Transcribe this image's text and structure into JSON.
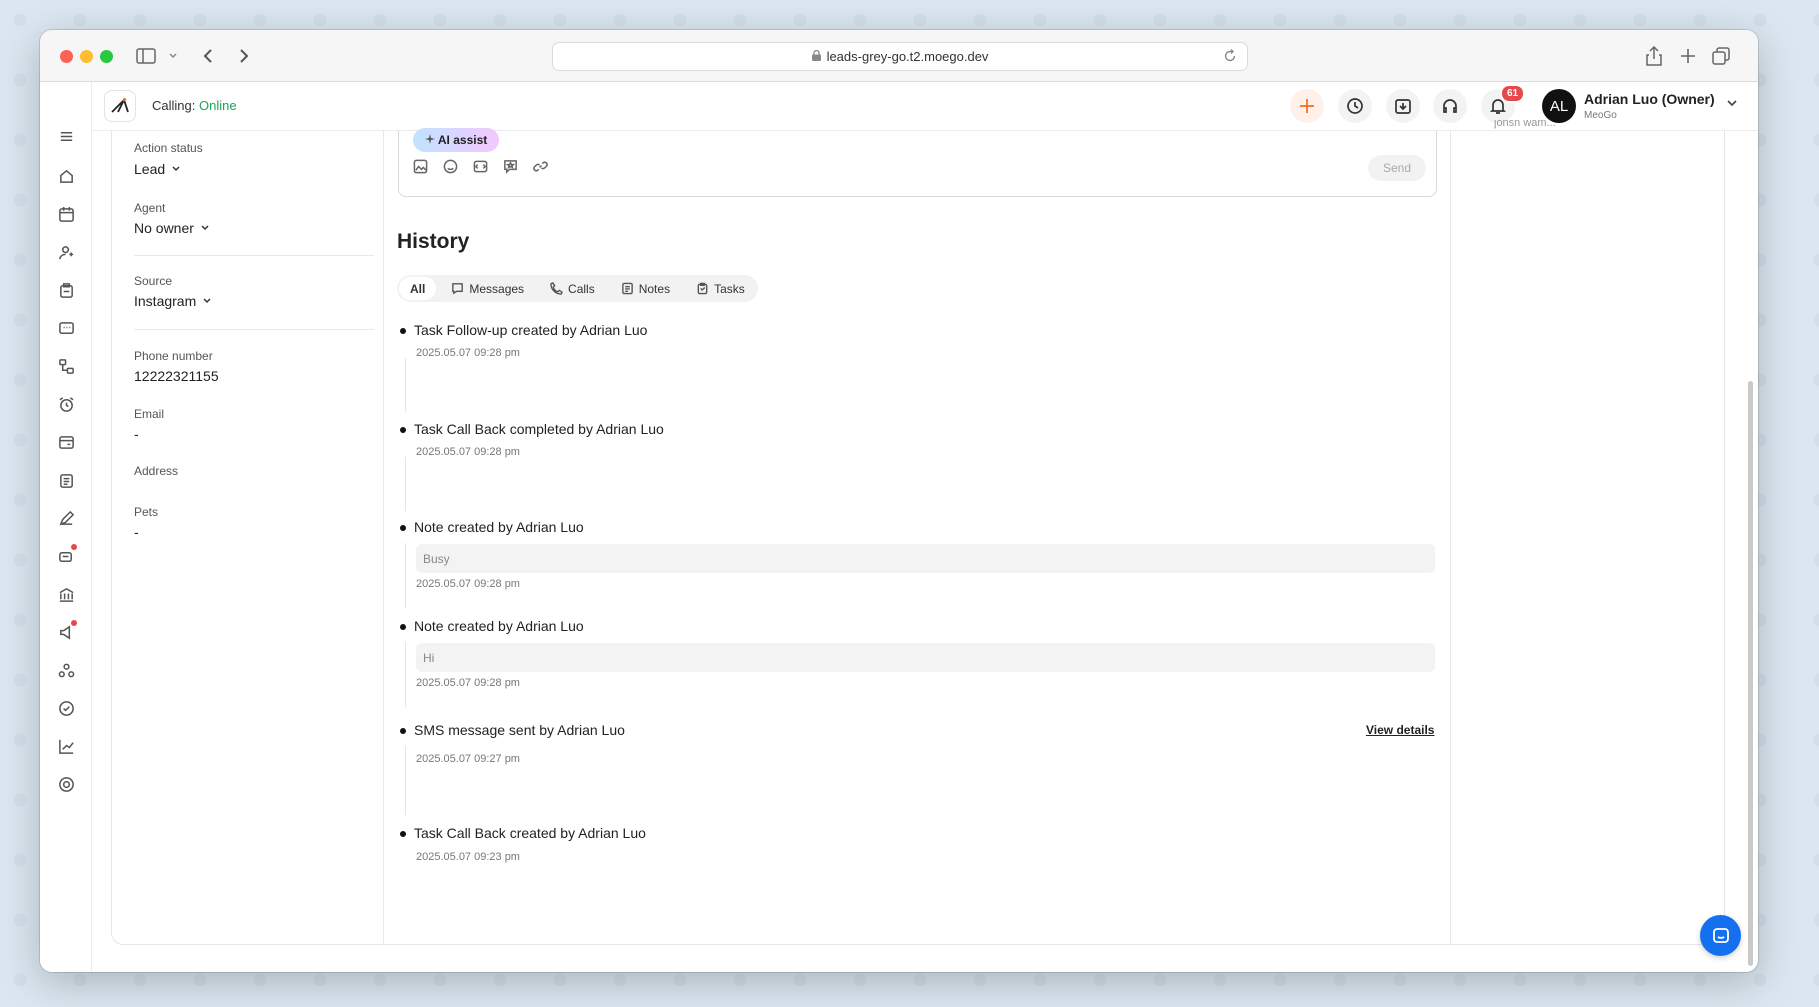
{
  "browser": {
    "url": "leads-grey-go.t2.moego.dev"
  },
  "header": {
    "calling_label": "Calling:",
    "calling_status": "Online",
    "notification_count": "61",
    "user_initials": "AL",
    "user_name": "Adrian Luo (Owner)",
    "business_name": "MeoGo"
  },
  "details": {
    "action_status": {
      "label": "Action status",
      "value": "Lead"
    },
    "agent": {
      "label": "Agent",
      "value": "No owner"
    },
    "source": {
      "label": "Source",
      "value": "Instagram"
    },
    "phone": {
      "label": "Phone number",
      "value": "12222321155"
    },
    "email": {
      "label": "Email",
      "value": "-"
    },
    "address": {
      "label": "Address"
    },
    "pets": {
      "label": "Pets",
      "value": "-"
    }
  },
  "composer": {
    "ai_assist_label": "AI assist",
    "send_label": "Send"
  },
  "history": {
    "title": "History",
    "tabs": [
      {
        "label": "All",
        "icon": "none"
      },
      {
        "label": "Messages",
        "icon": "message-icon"
      },
      {
        "label": "Calls",
        "icon": "phone-icon"
      },
      {
        "label": "Notes",
        "icon": "note-icon"
      },
      {
        "label": "Tasks",
        "icon": "clipboard-icon"
      }
    ],
    "events": [
      {
        "text": "Task Follow-up created by Adrian Luo",
        "date": "2025.05.07 09:28 pm"
      },
      {
        "text": "Task Call Back completed by Adrian Luo",
        "date": "2025.05.07 09:28 pm"
      },
      {
        "text": "Note created by Adrian Luo",
        "note": "Busy",
        "date": "2025.05.07 09:28 pm"
      },
      {
        "text": "Note created by Adrian Luo",
        "note": "Hi",
        "date": "2025.05.07 09:28 pm"
      },
      {
        "text": "SMS message sent by Adrian Luo",
        "date": "2025.05.07 09:27 pm",
        "link": "View details"
      },
      {
        "text": "Task Call Back created by Adrian Luo",
        "date": "2025.05.07 09:23 pm"
      }
    ]
  },
  "right_panel": {
    "truncated_text": "jonsn wam..."
  }
}
